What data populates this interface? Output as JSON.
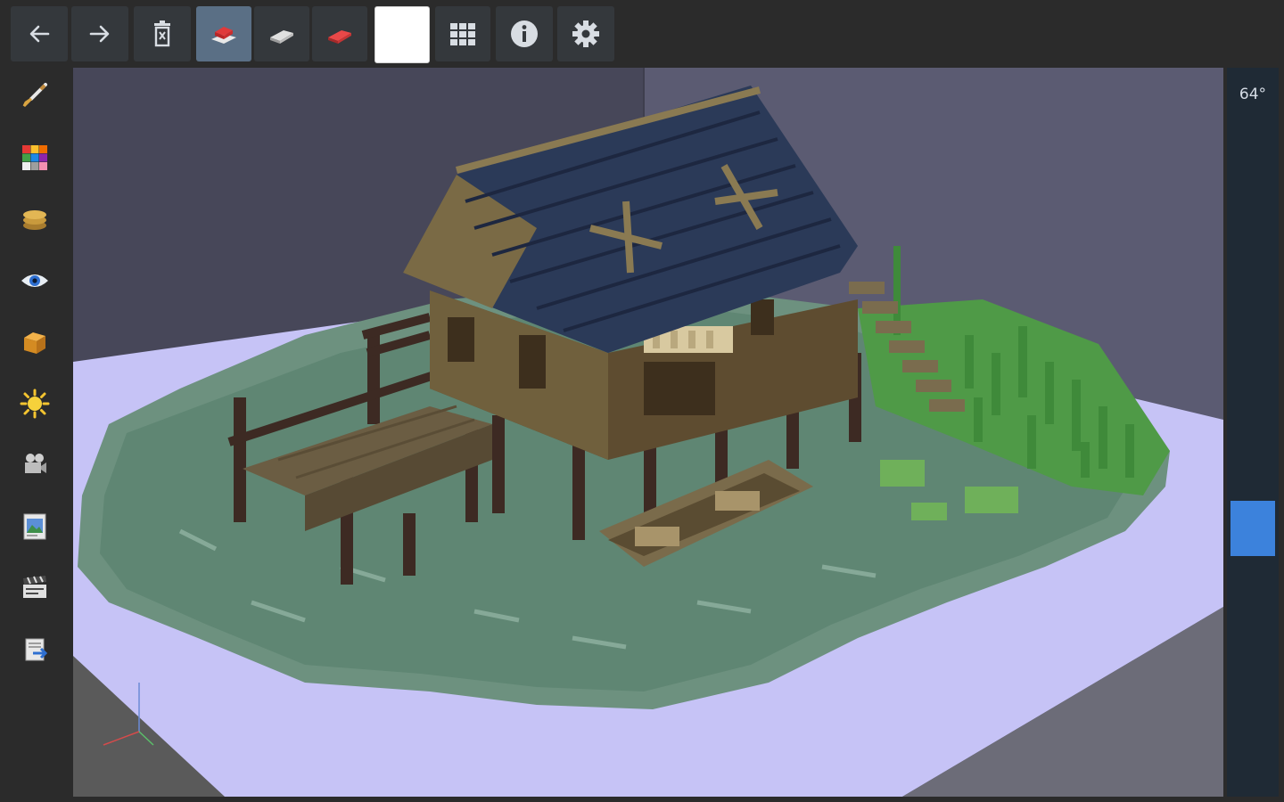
{
  "toolbar": {
    "buttons": [
      {
        "name": "undo-button",
        "icon": "arrow-left-icon",
        "active": false
      },
      {
        "name": "redo-button",
        "icon": "arrow-right-icon",
        "active": false
      },
      {
        "name": "clear-button",
        "icon": "trash-icon",
        "active": false
      },
      {
        "name": "add-block-tool",
        "icon": "block-add-icon",
        "active": true
      },
      {
        "name": "paint-block-tool",
        "icon": "block-paint-icon",
        "active": false
      },
      {
        "name": "remove-block-tool",
        "icon": "block-remove-icon",
        "active": false
      },
      {
        "name": "color-swatch",
        "icon": "",
        "active": false,
        "color": "#ffffff"
      },
      {
        "name": "grid-toggle",
        "icon": "grid-icon",
        "active": false
      },
      {
        "name": "info-button",
        "icon": "info-icon",
        "active": false
      },
      {
        "name": "settings-button",
        "icon": "gear-icon",
        "active": false
      }
    ]
  },
  "sidebar": {
    "items": [
      {
        "name": "sidebar-brush",
        "icon": "brush-icon"
      },
      {
        "name": "sidebar-palette",
        "icon": "palette-icon"
      },
      {
        "name": "sidebar-layers",
        "icon": "layers-icon"
      },
      {
        "name": "sidebar-visibility",
        "icon": "eye-icon"
      },
      {
        "name": "sidebar-block",
        "icon": "cube-icon"
      },
      {
        "name": "sidebar-lighting",
        "icon": "sun-icon"
      },
      {
        "name": "sidebar-camera",
        "icon": "camera-icon"
      },
      {
        "name": "sidebar-image",
        "icon": "image-icon"
      },
      {
        "name": "sidebar-render",
        "icon": "clapper-icon"
      },
      {
        "name": "sidebar-export",
        "icon": "export-icon"
      }
    ]
  },
  "camera": {
    "angle_label": "64°",
    "zoom_fraction": 0.63
  },
  "colors": {
    "active_tool": "#5a6f85",
    "accent": "#3c82dc",
    "floor": "#c6c3f6",
    "water": "#6b8e7d",
    "roof": "#2b3a58",
    "wood": "#6a5a3c",
    "grass": "#4f9a47"
  }
}
